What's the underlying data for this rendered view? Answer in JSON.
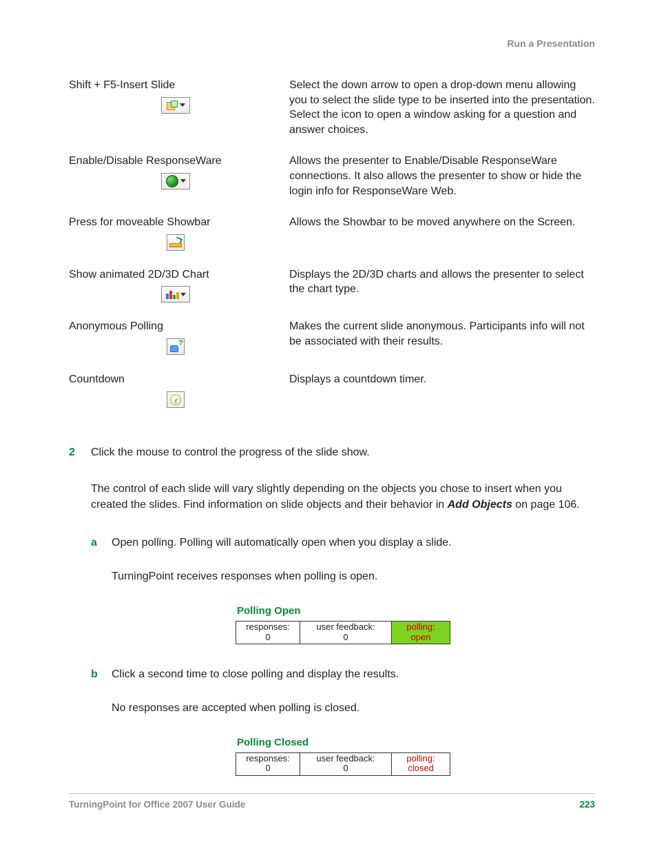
{
  "header": {
    "title": "Run a Presentation"
  },
  "rows": [
    {
      "label": "Shift + F5-Insert Slide",
      "desc": "Select the down arrow to open a drop-down menu allowing you to select the slide type to be inserted into the presentation. Select the icon to open a window asking for a question and answer choices."
    },
    {
      "label": "Enable/Disable ResponseWare",
      "desc": "Allows the presenter to Enable/Disable ResponseWare connections. It also allows the presenter to show or hide the login info for ResponseWare Web."
    },
    {
      "label": "Press for moveable Showbar",
      "desc": "Allows the Showbar to be moved anywhere on the Screen."
    },
    {
      "label": "Show animated 2D/3D Chart",
      "desc": "Displays the 2D/3D charts and allows the presenter to select the chart type."
    },
    {
      "label": "Anonymous Polling",
      "desc": "Makes the current slide anonymous. Participants info will not be associated with their results."
    },
    {
      "label": "Countdown",
      "desc": "Displays a countdown timer."
    }
  ],
  "step2": {
    "num": "2",
    "text": "Click the mouse to control the progress of the slide show.",
    "para_before": "The control of each slide will vary slightly depending on the objects you chose to insert when you created the slides. Find information on slide objects and their behavior in ",
    "para_em": "Add Objects",
    "para_after": " on page 106."
  },
  "sub_a": {
    "letter": "a",
    "text": "Open polling. Polling will automatically open when you display a slide.",
    "follow": "TurningPoint receives responses when polling is open."
  },
  "poll_open": {
    "title": "Polling Open",
    "c1_label": "responses:",
    "c1_val": "0",
    "c2_label": "user feedback:",
    "c2_val": "0",
    "c3_label": "polling:",
    "c3_val": "open"
  },
  "sub_b": {
    "letter": "b",
    "text": "Click a second time to close polling and display the results.",
    "follow": "No responses are accepted when polling is closed."
  },
  "poll_closed": {
    "title": "Polling Closed",
    "c1_label": "responses:",
    "c1_val": "0",
    "c2_label": "user feedback:",
    "c2_val": "0",
    "c3_label": "polling:",
    "c3_val": "closed"
  },
  "footer": {
    "left": "TurningPoint for Office 2007 User Guide",
    "right": "223"
  }
}
